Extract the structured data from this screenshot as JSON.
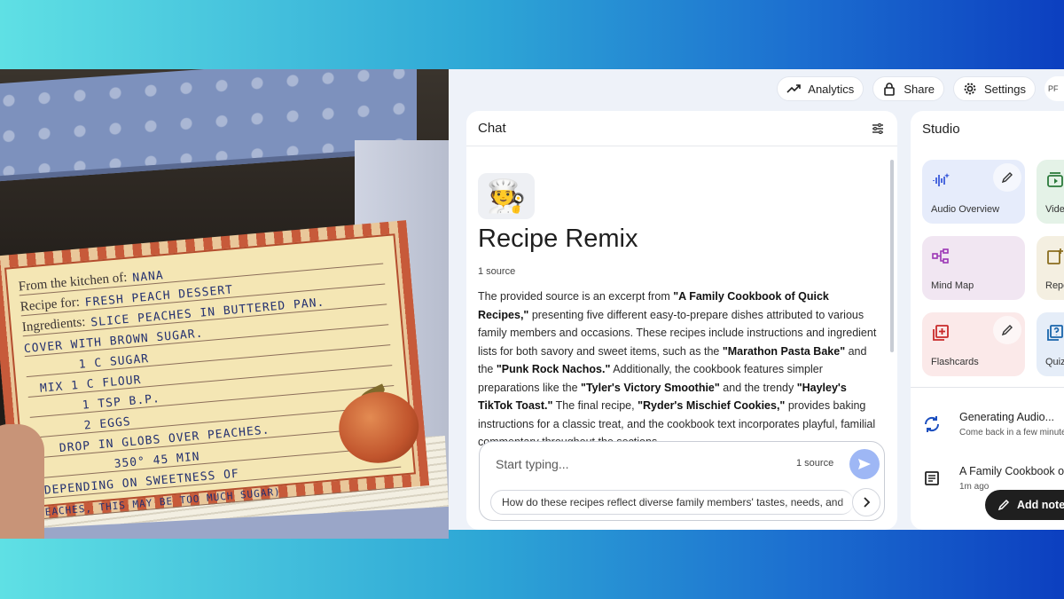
{
  "recipe_card": {
    "from_label": "From the kitchen of:",
    "from_value": "NANA",
    "recipe_label": "Recipe for:",
    "recipe_value": "FRESH PEACH DESSERT",
    "ingredients_label": "Ingredients:",
    "lines": [
      "SLICE PEACHES IN BUTTERED PAN.",
      "COVER WITH BROWN SUGAR.",
      "1 C SUGAR",
      "MIX  1 C FLOUR",
      "1 TSP B.P.",
      "2 EGGS",
      "DROP IN GLOBS OVER PEACHES.",
      "350°  45 MIN",
      "(DEPENDING ON SWEETNESS OF",
      "PEACHES, THIS MAY BE TOO MUCH SUGAR)"
    ]
  },
  "topbar": {
    "analytics": "Analytics",
    "share": "Share",
    "settings": "Settings",
    "avatar": "PF"
  },
  "chat": {
    "header": "Chat",
    "emoji": "🧑‍🍳",
    "notebook_title": "Recipe Remix",
    "source_count": "1 source",
    "summary_parts": [
      {
        "t": "The provided source is an excerpt from ",
        "b": false
      },
      {
        "t": "\"A Family Cookbook of Quick Recipes,\"",
        "b": true
      },
      {
        "t": " presenting five different easy-to-prepare dishes attributed to various family members and occasions. These recipes include instructions and ingredient lists for both savory and sweet items, such as the ",
        "b": false
      },
      {
        "t": "\"Marathon Pasta Bake\"",
        "b": true
      },
      {
        "t": " and the ",
        "b": false
      },
      {
        "t": "\"Punk Rock Nachos.\"",
        "b": true
      },
      {
        "t": " Additionally, the cookbook features simpler preparations like the ",
        "b": false
      },
      {
        "t": "\"Tyler's Victory Smoothie\"",
        "b": true
      },
      {
        "t": " and the trendy ",
        "b": false
      },
      {
        "t": "\"Hayley's TikTok Toast.\"",
        "b": true
      },
      {
        "t": " The final recipe, ",
        "b": false
      },
      {
        "t": "\"Ryder's Mischief Cookies,\"",
        "b": true
      },
      {
        "t": " provides baking instructions for a classic treat, and the cookbook text incorporates playful, familial commentary throughout the sections.",
        "b": false
      }
    ],
    "input_placeholder": "Start typing...",
    "composer_source_count": "1 source",
    "suggestion": "How do these recipes reflect diverse family members' tastes, needs, and"
  },
  "studio": {
    "header": "Studio",
    "tiles": [
      {
        "label": "Audio Overview",
        "icon": "audio-waveform-icon"
      },
      {
        "label": "Video",
        "icon": "video-icon"
      },
      {
        "label": "Mind Map",
        "icon": "mind-map-icon"
      },
      {
        "label": "Reports",
        "icon": "reports-icon"
      },
      {
        "label": "Flashcards",
        "icon": "flashcards-icon"
      },
      {
        "label": "Quiz",
        "icon": "quiz-icon"
      }
    ],
    "notes": [
      {
        "title": "Generating Audio...",
        "sub": "Come back in a few minutes"
      },
      {
        "title": "A Family Cookbook of Quick Recipes",
        "sub": "1m ago"
      }
    ],
    "add_note": "Add note"
  },
  "colors": {
    "accent_send": "#9eb7f5",
    "card_border": "#c75a3a",
    "card_paper": "#f4e6b4"
  }
}
